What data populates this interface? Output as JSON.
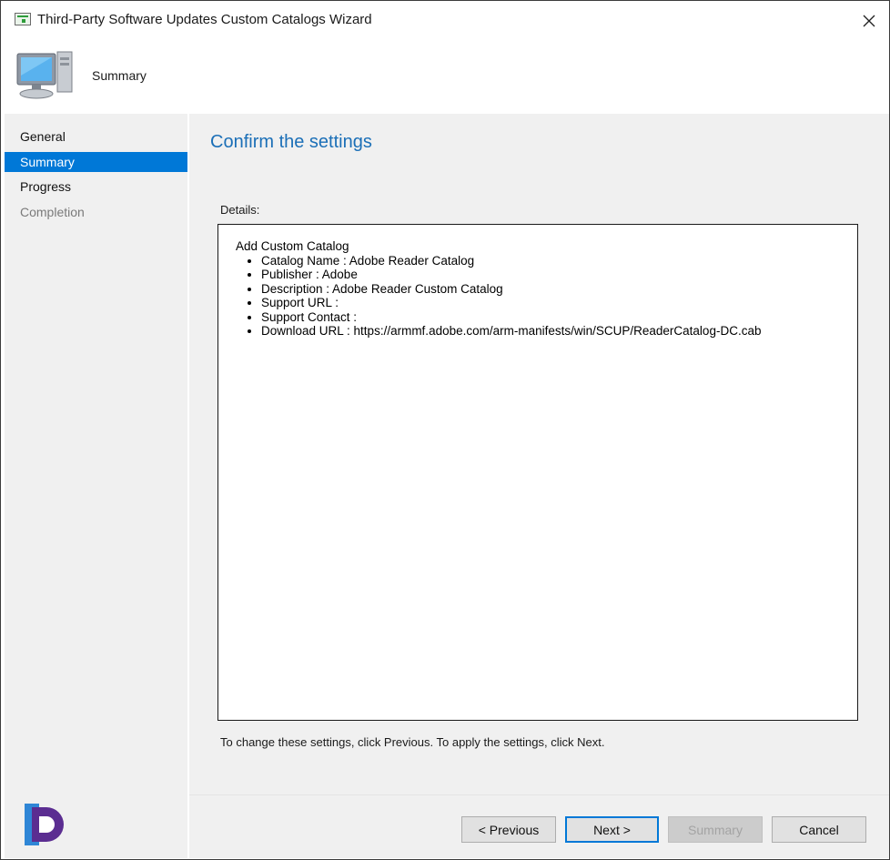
{
  "window": {
    "title": "Third-Party Software Updates Custom Catalogs Wizard"
  },
  "header": {
    "title": "Summary"
  },
  "sidebar": {
    "items": [
      {
        "label": "General",
        "state": "normal"
      },
      {
        "label": "Summary",
        "state": "active"
      },
      {
        "label": "Progress",
        "state": "normal"
      },
      {
        "label": "Completion",
        "state": "disabled"
      }
    ]
  },
  "main": {
    "heading": "Confirm the settings",
    "details_label": "Details:",
    "details": {
      "header": "Add Custom Catalog",
      "items": [
        "Catalog Name : Adobe Reader Catalog",
        "Publisher : Adobe",
        "Description : Adobe Reader Custom Catalog",
        "Support URL :",
        "Support Contact :",
        "Download URL : https://armmf.adobe.com/arm-manifests/win/SCUP/ReaderCatalog-DC.cab"
      ]
    },
    "hint": "To change these settings, click Previous. To apply the settings, click Next."
  },
  "buttons": {
    "previous": "< Previous",
    "next": "Next >",
    "summary": "Summary",
    "cancel": "Cancel"
  },
  "colors": {
    "accent": "#0078d7",
    "heading": "#1b6fb7",
    "panel_background": "#f0f0f0"
  },
  "icons": [
    "app-window-icon",
    "close-icon",
    "computer-icon",
    "brand-logo-icon"
  ]
}
